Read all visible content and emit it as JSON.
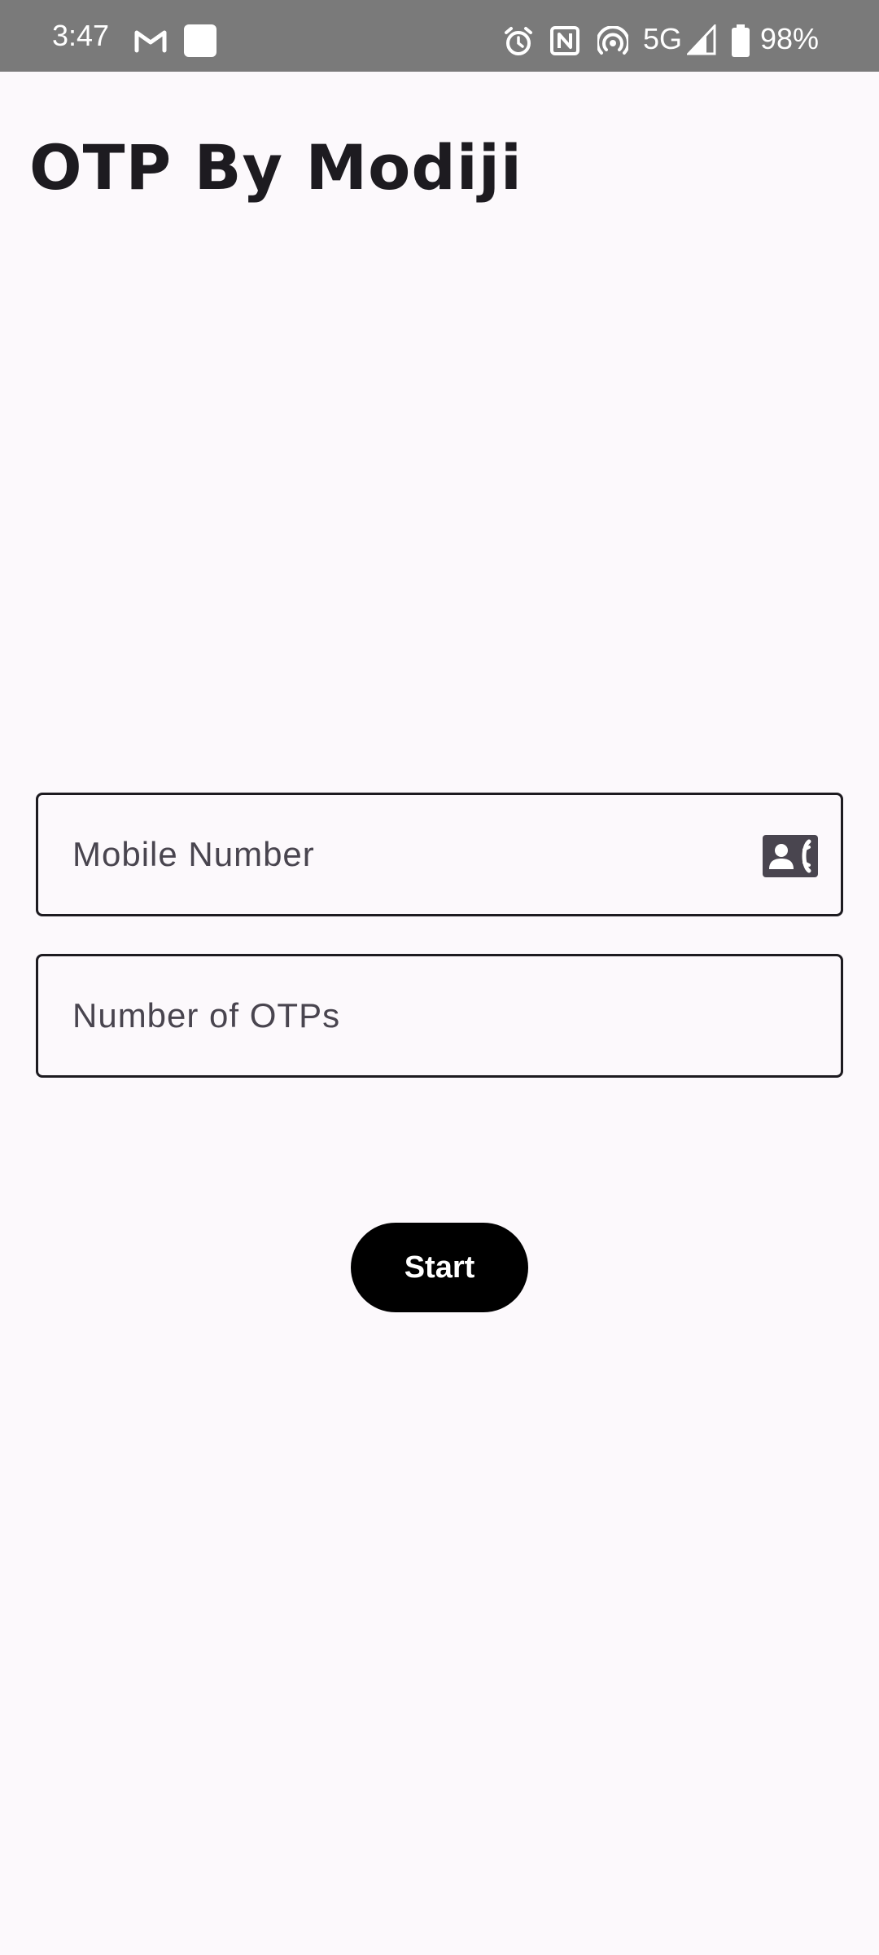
{
  "status_bar": {
    "time": "3:47",
    "network": "5G",
    "battery": "98%",
    "icons": [
      "gmail-icon",
      "square-notification-icon",
      "alarm-icon",
      "nfc-icon",
      "hotspot-icon",
      "signal-icon",
      "battery-icon"
    ]
  },
  "app": {
    "title": "OTP By Modiji"
  },
  "form": {
    "mobile_placeholder": "Mobile Number",
    "mobile_value": "",
    "mobile_icon": "contact-phone-icon",
    "otps_placeholder": "Number of OTPs",
    "otps_value": "",
    "start_label": "Start"
  },
  "colors": {
    "status_bar_bg": "#7a7a7a",
    "page_bg": "#fcf9fc",
    "button_bg": "#000000",
    "button_text": "#ffffff",
    "text_primary": "#1d1b20",
    "placeholder": "#49454f"
  }
}
